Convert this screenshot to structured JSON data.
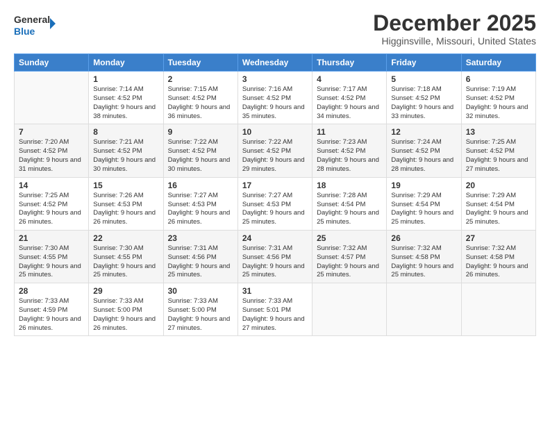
{
  "logo": {
    "general": "General",
    "blue": "Blue"
  },
  "header": {
    "month": "December 2025",
    "location": "Higginsville, Missouri, United States"
  },
  "weekdays": [
    "Sunday",
    "Monday",
    "Tuesday",
    "Wednesday",
    "Thursday",
    "Friday",
    "Saturday"
  ],
  "weeks": [
    [
      {
        "day": "",
        "sunrise": "",
        "sunset": "",
        "daylight": ""
      },
      {
        "day": "1",
        "sunrise": "Sunrise: 7:14 AM",
        "sunset": "Sunset: 4:52 PM",
        "daylight": "Daylight: 9 hours and 38 minutes."
      },
      {
        "day": "2",
        "sunrise": "Sunrise: 7:15 AM",
        "sunset": "Sunset: 4:52 PM",
        "daylight": "Daylight: 9 hours and 36 minutes."
      },
      {
        "day": "3",
        "sunrise": "Sunrise: 7:16 AM",
        "sunset": "Sunset: 4:52 PM",
        "daylight": "Daylight: 9 hours and 35 minutes."
      },
      {
        "day": "4",
        "sunrise": "Sunrise: 7:17 AM",
        "sunset": "Sunset: 4:52 PM",
        "daylight": "Daylight: 9 hours and 34 minutes."
      },
      {
        "day": "5",
        "sunrise": "Sunrise: 7:18 AM",
        "sunset": "Sunset: 4:52 PM",
        "daylight": "Daylight: 9 hours and 33 minutes."
      },
      {
        "day": "6",
        "sunrise": "Sunrise: 7:19 AM",
        "sunset": "Sunset: 4:52 PM",
        "daylight": "Daylight: 9 hours and 32 minutes."
      }
    ],
    [
      {
        "day": "7",
        "sunrise": "Sunrise: 7:20 AM",
        "sunset": "Sunset: 4:52 PM",
        "daylight": "Daylight: 9 hours and 31 minutes."
      },
      {
        "day": "8",
        "sunrise": "Sunrise: 7:21 AM",
        "sunset": "Sunset: 4:52 PM",
        "daylight": "Daylight: 9 hours and 30 minutes."
      },
      {
        "day": "9",
        "sunrise": "Sunrise: 7:22 AM",
        "sunset": "Sunset: 4:52 PM",
        "daylight": "Daylight: 9 hours and 30 minutes."
      },
      {
        "day": "10",
        "sunrise": "Sunrise: 7:22 AM",
        "sunset": "Sunset: 4:52 PM",
        "daylight": "Daylight: 9 hours and 29 minutes."
      },
      {
        "day": "11",
        "sunrise": "Sunrise: 7:23 AM",
        "sunset": "Sunset: 4:52 PM",
        "daylight": "Daylight: 9 hours and 28 minutes."
      },
      {
        "day": "12",
        "sunrise": "Sunrise: 7:24 AM",
        "sunset": "Sunset: 4:52 PM",
        "daylight": "Daylight: 9 hours and 28 minutes."
      },
      {
        "day": "13",
        "sunrise": "Sunrise: 7:25 AM",
        "sunset": "Sunset: 4:52 PM",
        "daylight": "Daylight: 9 hours and 27 minutes."
      }
    ],
    [
      {
        "day": "14",
        "sunrise": "Sunrise: 7:25 AM",
        "sunset": "Sunset: 4:52 PM",
        "daylight": "Daylight: 9 hours and 26 minutes."
      },
      {
        "day": "15",
        "sunrise": "Sunrise: 7:26 AM",
        "sunset": "Sunset: 4:53 PM",
        "daylight": "Daylight: 9 hours and 26 minutes."
      },
      {
        "day": "16",
        "sunrise": "Sunrise: 7:27 AM",
        "sunset": "Sunset: 4:53 PM",
        "daylight": "Daylight: 9 hours and 26 minutes."
      },
      {
        "day": "17",
        "sunrise": "Sunrise: 7:27 AM",
        "sunset": "Sunset: 4:53 PM",
        "daylight": "Daylight: 9 hours and 25 minutes."
      },
      {
        "day": "18",
        "sunrise": "Sunrise: 7:28 AM",
        "sunset": "Sunset: 4:54 PM",
        "daylight": "Daylight: 9 hours and 25 minutes."
      },
      {
        "day": "19",
        "sunrise": "Sunrise: 7:29 AM",
        "sunset": "Sunset: 4:54 PM",
        "daylight": "Daylight: 9 hours and 25 minutes."
      },
      {
        "day": "20",
        "sunrise": "Sunrise: 7:29 AM",
        "sunset": "Sunset: 4:54 PM",
        "daylight": "Daylight: 9 hours and 25 minutes."
      }
    ],
    [
      {
        "day": "21",
        "sunrise": "Sunrise: 7:30 AM",
        "sunset": "Sunset: 4:55 PM",
        "daylight": "Daylight: 9 hours and 25 minutes."
      },
      {
        "day": "22",
        "sunrise": "Sunrise: 7:30 AM",
        "sunset": "Sunset: 4:55 PM",
        "daylight": "Daylight: 9 hours and 25 minutes."
      },
      {
        "day": "23",
        "sunrise": "Sunrise: 7:31 AM",
        "sunset": "Sunset: 4:56 PM",
        "daylight": "Daylight: 9 hours and 25 minutes."
      },
      {
        "day": "24",
        "sunrise": "Sunrise: 7:31 AM",
        "sunset": "Sunset: 4:56 PM",
        "daylight": "Daylight: 9 hours and 25 minutes."
      },
      {
        "day": "25",
        "sunrise": "Sunrise: 7:32 AM",
        "sunset": "Sunset: 4:57 PM",
        "daylight": "Daylight: 9 hours and 25 minutes."
      },
      {
        "day": "26",
        "sunrise": "Sunrise: 7:32 AM",
        "sunset": "Sunset: 4:58 PM",
        "daylight": "Daylight: 9 hours and 25 minutes."
      },
      {
        "day": "27",
        "sunrise": "Sunrise: 7:32 AM",
        "sunset": "Sunset: 4:58 PM",
        "daylight": "Daylight: 9 hours and 26 minutes."
      }
    ],
    [
      {
        "day": "28",
        "sunrise": "Sunrise: 7:33 AM",
        "sunset": "Sunset: 4:59 PM",
        "daylight": "Daylight: 9 hours and 26 minutes."
      },
      {
        "day": "29",
        "sunrise": "Sunrise: 7:33 AM",
        "sunset": "Sunset: 5:00 PM",
        "daylight": "Daylight: 9 hours and 26 minutes."
      },
      {
        "day": "30",
        "sunrise": "Sunrise: 7:33 AM",
        "sunset": "Sunset: 5:00 PM",
        "daylight": "Daylight: 9 hours and 27 minutes."
      },
      {
        "day": "31",
        "sunrise": "Sunrise: 7:33 AM",
        "sunset": "Sunset: 5:01 PM",
        "daylight": "Daylight: 9 hours and 27 minutes."
      },
      {
        "day": "",
        "sunrise": "",
        "sunset": "",
        "daylight": ""
      },
      {
        "day": "",
        "sunrise": "",
        "sunset": "",
        "daylight": ""
      },
      {
        "day": "",
        "sunrise": "",
        "sunset": "",
        "daylight": ""
      }
    ]
  ]
}
